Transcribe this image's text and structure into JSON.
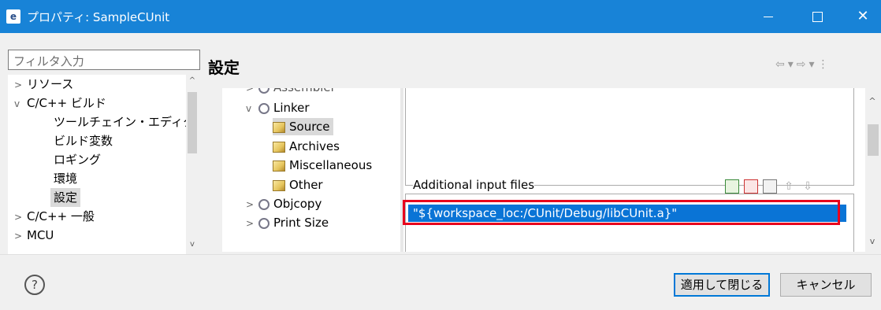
{
  "window": {
    "title": "プロパティ: SampleCUnit",
    "app_icon": "eclipse-icon"
  },
  "filter": {
    "placeholder": "フィルタ入力"
  },
  "tree": {
    "items": [
      {
        "label": "リソース",
        "expander": ">"
      },
      {
        "label": "C/C++ ビルド",
        "expander": "v"
      },
      {
        "label": "ツールチェイン・エディター"
      },
      {
        "label": "ビルド変数"
      },
      {
        "label": "ロギング"
      },
      {
        "label": "環境"
      },
      {
        "label": "設定",
        "selected": true
      },
      {
        "label": "C/C++ 一般",
        "expander": ">"
      },
      {
        "label": "MCU",
        "expander": ">"
      }
    ]
  },
  "page": {
    "heading": "設定"
  },
  "tool_tree": {
    "items": [
      {
        "label": "Assembler",
        "icon": "gear-icon"
      },
      {
        "label": "Linker",
        "icon": "gear-icon"
      },
      {
        "label": "Source",
        "icon": "tool-icon",
        "selected": true
      },
      {
        "label": "Archives",
        "icon": "tool-icon"
      },
      {
        "label": "Miscellaneous",
        "icon": "tool-icon"
      },
      {
        "label": "Other",
        "icon": "tool-icon"
      },
      {
        "label": "Objcopy",
        "icon": "gear-icon"
      },
      {
        "label": "Print Size",
        "icon": "gear-icon"
      }
    ]
  },
  "input_files": {
    "label": "Additional input files",
    "files": [
      "\"${workspace_loc:/CUnit/Debug/libCUnit.a}\""
    ]
  },
  "buttons": {
    "apply_close": "適用して閉じる",
    "cancel": "キャンセル"
  },
  "colors": {
    "titlebar": "#1883d7",
    "selection": "#0a74d6",
    "highlight_box": "#e8001c"
  }
}
